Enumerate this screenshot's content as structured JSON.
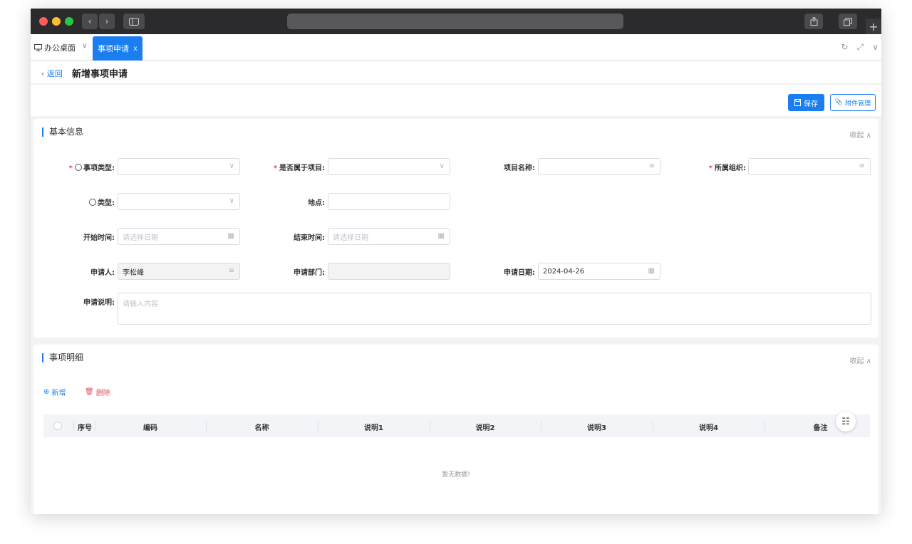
{
  "browser": {
    "new_tab_symbol": "+"
  },
  "tabs": {
    "home_label": "办公桌面",
    "active_label": "事项申请",
    "active_close": "x"
  },
  "header": {
    "back_label": "返回",
    "title": "新增事项申请"
  },
  "toolbar": {
    "save_label": "保存",
    "attach_label": "附件管理"
  },
  "basic": {
    "section_title": "基本信息",
    "collapse_label": "收起",
    "item_type_label": "事项类型:",
    "belongs_project_label": "是否属于项目:",
    "project_name_label": "项目名称:",
    "org_label": "所属组织:",
    "type_label": "类型:",
    "location_label": "地点:",
    "start_time_label": "开始时间:",
    "start_time_placeholder": "请选择日期",
    "end_time_label": "结束时间:",
    "end_time_placeholder": "请选择日期",
    "applicant_label": "申请人:",
    "applicant_value": "李松峰",
    "dept_label": "申请部门:",
    "apply_date_label": "申请日期:",
    "apply_date_value": "2024-04-26",
    "desc_label": "申请说明:",
    "desc_placeholder": "请输入内容"
  },
  "detail": {
    "section_title": "事项明细",
    "collapse_label": "收起",
    "add_label": "新增",
    "delete_label": "删除",
    "columns": [
      "序号",
      "编码",
      "名称",
      "说明1",
      "说明2",
      "说明3",
      "说明4",
      "备注"
    ],
    "empty_text": "暂无数据!"
  },
  "colors": {
    "primary": "#1a7ef0",
    "danger": "#e34d59"
  }
}
